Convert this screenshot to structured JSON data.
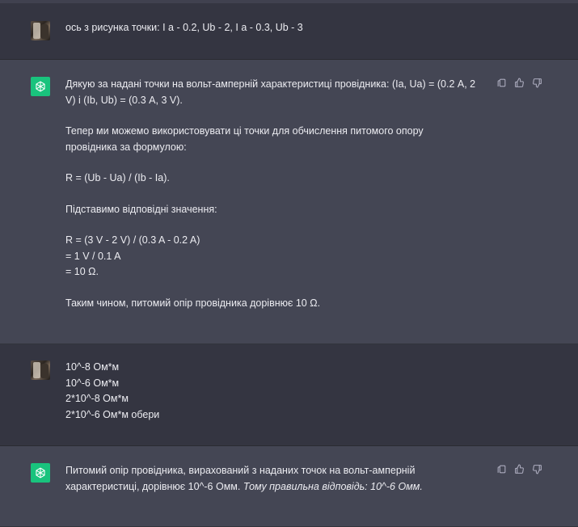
{
  "messages": [
    {
      "role": "user",
      "text": "ось з рисунка точки: I a - 0.2, Ub - 2, I a - 0.3, Ub - 3"
    },
    {
      "role": "assistant",
      "paragraphs": [
        "Дякую за надані точки на вольт-амперній характеристиці провідника: (Ia, Ua) = (0.2 A, 2 V) і (Ib, Ub) = (0.3 A, 3 V).",
        "Тепер ми можемо використовувати ці точки для обчислення питомого опору провідника за формулою:",
        "R = (Ub - Ua) / (Ib - Ia).",
        "Підставимо відповідні значення:",
        "R = (3 V - 2 V) / (0.3 A - 0.2 A)\n= 1 V / 0.1 A\n= 10 Ω.",
        "Таким чином, питомий опір провідника дорівнює 10 Ω."
      ],
      "actions": [
        "copy-icon",
        "thumbs-up-icon",
        "thumbs-down-icon"
      ]
    },
    {
      "role": "user",
      "lines": [
        "10^-8 Ом*м",
        "10^-6 Ом*м",
        "2*10^-8 Ом*м",
        "2*10^-6 Ом*м обери"
      ]
    },
    {
      "role": "assistant",
      "text_plain": "Питомий опір провідника, вирахований з наданих точок на вольт-амперній характеристиці, дорівнює 10^-6 Омм. ",
      "text_italic": "Тому правильна відповідь: 10^-6 Омм.",
      "actions": [
        "copy-icon",
        "thumbs-up-icon",
        "thumbs-down-icon"
      ]
    }
  ],
  "colors": {
    "user_bg": "#343541",
    "assistant_bg": "#444654",
    "assistant_avatar": "#19c37d",
    "text": "#ececf1",
    "icon": "#acacbe"
  }
}
